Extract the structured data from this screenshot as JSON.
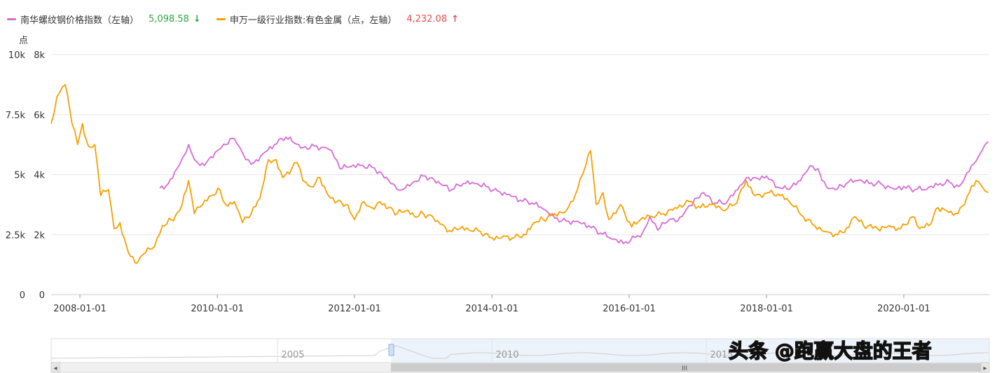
{
  "legend": {
    "series1": {
      "name": "南华螺纹钢价格指数（左轴）",
      "value": "5,098.58",
      "arrow": "↓",
      "color": "#d66bd6"
    },
    "series2": {
      "name": "申万一级行业指数:有色金属（点，左轴）",
      "value": "4,232.08",
      "arrow": "↑",
      "color": "#f5a000"
    }
  },
  "watermark": "头条 @跑赢大盘的王者",
  "navigator": {
    "labels": [
      "2005",
      "2010",
      "2015"
    ],
    "scroll_left": "◂",
    "scroll_right": "▸",
    "grip": "III"
  },
  "colors": {
    "grid": "#e6e6e6",
    "axis_text": "#333333",
    "up": "#e44d4d",
    "down": "#28a745"
  },
  "chart_data": {
    "type": "line",
    "y_unit_label": "点",
    "y_axis_outer": {
      "ticks": [
        "0",
        "2.5k",
        "5k",
        "7.5k",
        "10k"
      ],
      "ylim": [
        0,
        10000
      ]
    },
    "y_axis_inner": {
      "ticks": [
        "0",
        "2k",
        "4k",
        "6k",
        "8k"
      ],
      "ylim": [
        0,
        8000
      ]
    },
    "x_ticks": [
      "2008-01-01",
      "2010-01-01",
      "2012-01-01",
      "2014-01-01",
      "2016-01-01",
      "2018-01-01",
      "2020-01-01"
    ],
    "xlim": [
      "2007-08-01",
      "2021-03-31"
    ],
    "grid": true,
    "series": [
      {
        "name": "南华螺纹钢价格指数（左轴）",
        "color": "#d66bd6",
        "axis": "inner",
        "points": [
          [
            "2009-03-01",
            3550
          ],
          [
            "2009-04-15",
            3700
          ],
          [
            "2009-06-01",
            4200
          ],
          [
            "2009-07-15",
            4700
          ],
          [
            "2009-08-01",
            5000
          ],
          [
            "2009-09-01",
            4500
          ],
          [
            "2009-10-01",
            4300
          ],
          [
            "2009-11-15",
            4500
          ],
          [
            "2010-01-01",
            4800
          ],
          [
            "2010-02-15",
            5000
          ],
          [
            "2010-04-01",
            5200
          ],
          [
            "2010-05-01",
            4900
          ],
          [
            "2010-06-01",
            4500
          ],
          [
            "2010-07-15",
            4400
          ],
          [
            "2010-09-01",
            4700
          ],
          [
            "2010-11-01",
            5000
          ],
          [
            "2011-01-01",
            5250
          ],
          [
            "2011-02-15",
            5050
          ],
          [
            "2011-04-01",
            4900
          ],
          [
            "2011-06-01",
            4950
          ],
          [
            "2011-08-01",
            4900
          ],
          [
            "2011-09-01",
            4800
          ],
          [
            "2011-10-15",
            4200
          ],
          [
            "2011-12-01",
            4250
          ],
          [
            "2012-02-01",
            4300
          ],
          [
            "2012-04-01",
            4250
          ],
          [
            "2012-05-15",
            4100
          ],
          [
            "2012-07-01",
            3800
          ],
          [
            "2012-08-15",
            3500
          ],
          [
            "2012-09-15",
            3500
          ],
          [
            "2012-11-01",
            3700
          ],
          [
            "2013-01-01",
            3950
          ],
          [
            "2013-02-15",
            3900
          ],
          [
            "2013-04-01",
            3700
          ],
          [
            "2013-06-01",
            3500
          ],
          [
            "2013-08-01",
            3700
          ],
          [
            "2013-10-01",
            3700
          ],
          [
            "2013-12-01",
            3600
          ],
          [
            "2014-02-01",
            3450
          ],
          [
            "2014-04-01",
            3350
          ],
          [
            "2014-06-01",
            3150
          ],
          [
            "2014-08-01",
            3050
          ],
          [
            "2014-10-01",
            2850
          ],
          [
            "2014-12-01",
            2550
          ],
          [
            "2015-02-01",
            2450
          ],
          [
            "2015-04-01",
            2450
          ],
          [
            "2015-06-01",
            2300
          ],
          [
            "2015-08-01",
            2050
          ],
          [
            "2015-10-01",
            1850
          ],
          [
            "2015-12-01",
            1700
          ],
          [
            "2016-02-01",
            1900
          ],
          [
            "2016-03-15",
            2100
          ],
          [
            "2016-04-20",
            2600
          ],
          [
            "2016-06-01",
            2150
          ],
          [
            "2016-08-01",
            2500
          ],
          [
            "2016-09-15",
            2450
          ],
          [
            "2016-11-01",
            2850
          ],
          [
            "2016-12-15",
            3200
          ],
          [
            "2017-02-01",
            3400
          ],
          [
            "2017-04-01",
            3050
          ],
          [
            "2017-06-01",
            3050
          ],
          [
            "2017-08-01",
            3500
          ],
          [
            "2017-09-15",
            3900
          ],
          [
            "2017-11-01",
            3900
          ],
          [
            "2018-01-01",
            3950
          ],
          [
            "2018-03-15",
            3550
          ],
          [
            "2018-05-01",
            3500
          ],
          [
            "2018-07-01",
            3800
          ],
          [
            "2018-08-20",
            4300
          ],
          [
            "2018-10-01",
            4200
          ],
          [
            "2018-11-15",
            3600
          ],
          [
            "2019-01-01",
            3500
          ],
          [
            "2019-03-01",
            3700
          ],
          [
            "2019-05-01",
            3800
          ],
          [
            "2019-07-01",
            3700
          ],
          [
            "2019-09-01",
            3700
          ],
          [
            "2019-11-01",
            3550
          ],
          [
            "2020-01-01",
            3600
          ],
          [
            "2020-03-01",
            3500
          ],
          [
            "2020-05-01",
            3500
          ],
          [
            "2020-07-01",
            3650
          ],
          [
            "2020-09-01",
            3750
          ],
          [
            "2020-10-20",
            3600
          ],
          [
            "2020-12-01",
            4050
          ],
          [
            "2021-01-20",
            4450
          ],
          [
            "2021-02-20",
            4800
          ],
          [
            "2021-03-25",
            5100
          ]
        ]
      },
      {
        "name": "申万一级行业指数:有色金属（点，左轴）",
        "color": "#f5a000",
        "axis": "inner",
        "points": [
          [
            "2007-08-01",
            5700
          ],
          [
            "2007-09-01",
            6600
          ],
          [
            "2007-10-15",
            7000
          ],
          [
            "2007-11-20",
            5700
          ],
          [
            "2007-12-20",
            5000
          ],
          [
            "2008-01-15",
            5700
          ],
          [
            "2008-02-01",
            5200
          ],
          [
            "2008-03-01",
            4900
          ],
          [
            "2008-03-20",
            5000
          ],
          [
            "2008-04-20",
            3300
          ],
          [
            "2008-06-01",
            3500
          ],
          [
            "2008-07-01",
            2200
          ],
          [
            "2008-08-01",
            2400
          ],
          [
            "2008-09-15",
            1400
          ],
          [
            "2008-11-01",
            1050
          ],
          [
            "2008-12-15",
            1400
          ],
          [
            "2009-02-01",
            1600
          ],
          [
            "2009-03-15",
            2300
          ],
          [
            "2009-05-01",
            2500
          ],
          [
            "2009-06-15",
            2800
          ],
          [
            "2009-08-01",
            3800
          ],
          [
            "2009-09-01",
            2700
          ],
          [
            "2009-10-15",
            3000
          ],
          [
            "2009-12-01",
            3300
          ],
          [
            "2010-01-15",
            3500
          ],
          [
            "2010-02-15",
            3000
          ],
          [
            "2010-04-01",
            3100
          ],
          [
            "2010-05-15",
            2400
          ],
          [
            "2010-07-01",
            2700
          ],
          [
            "2010-08-15",
            3200
          ],
          [
            "2010-10-01",
            4500
          ],
          [
            "2010-11-10",
            4500
          ],
          [
            "2010-12-15",
            3900
          ],
          [
            "2011-02-01",
            4200
          ],
          [
            "2011-03-01",
            4400
          ],
          [
            "2011-04-01",
            3800
          ],
          [
            "2011-05-15",
            3600
          ],
          [
            "2011-07-01",
            3900
          ],
          [
            "2011-08-15",
            3300
          ],
          [
            "2011-10-01",
            3100
          ],
          [
            "2011-11-15",
            3000
          ],
          [
            "2012-01-01",
            2500
          ],
          [
            "2012-02-20",
            3100
          ],
          [
            "2012-04-01",
            2900
          ],
          [
            "2012-05-15",
            3100
          ],
          [
            "2012-07-01",
            2900
          ],
          [
            "2012-08-15",
            2700
          ],
          [
            "2012-10-01",
            2800
          ],
          [
            "2012-11-15",
            2600
          ],
          [
            "2013-01-01",
            2700
          ],
          [
            "2013-02-20",
            2600
          ],
          [
            "2013-04-01",
            2350
          ],
          [
            "2013-06-01",
            2100
          ],
          [
            "2013-07-15",
            2200
          ],
          [
            "2013-09-01",
            2150
          ],
          [
            "2013-11-01",
            2100
          ],
          [
            "2014-01-01",
            1900
          ],
          [
            "2014-03-01",
            1950
          ],
          [
            "2014-05-01",
            1900
          ],
          [
            "2014-07-01",
            2000
          ],
          [
            "2014-08-15",
            2400
          ],
          [
            "2014-10-01",
            2500
          ],
          [
            "2014-12-01",
            2700
          ],
          [
            "2015-02-01",
            2800
          ],
          [
            "2015-04-01",
            3500
          ],
          [
            "2015-05-15",
            4300
          ],
          [
            "2015-06-10",
            4800
          ],
          [
            "2015-07-10",
            3000
          ],
          [
            "2015-08-15",
            3400
          ],
          [
            "2015-09-15",
            2500
          ],
          [
            "2015-11-15",
            3000
          ],
          [
            "2016-01-15",
            2250
          ],
          [
            "2016-03-01",
            2500
          ],
          [
            "2016-05-01",
            2600
          ],
          [
            "2016-07-01",
            2700
          ],
          [
            "2016-09-01",
            2900
          ],
          [
            "2016-11-15",
            3100
          ],
          [
            "2017-01-15",
            2900
          ],
          [
            "2017-03-15",
            3000
          ],
          [
            "2017-05-15",
            2800
          ],
          [
            "2017-07-15",
            3000
          ],
          [
            "2017-09-15",
            3800
          ],
          [
            "2017-11-01",
            3300
          ],
          [
            "2018-01-15",
            3400
          ],
          [
            "2018-03-15",
            3300
          ],
          [
            "2018-05-01",
            3100
          ],
          [
            "2018-07-15",
            2600
          ],
          [
            "2018-09-15",
            2300
          ],
          [
            "2018-11-15",
            2100
          ],
          [
            "2019-01-15",
            2000
          ],
          [
            "2019-03-15",
            2250
          ],
          [
            "2019-04-15",
            2600
          ],
          [
            "2019-06-01",
            2300
          ],
          [
            "2019-08-15",
            2200
          ],
          [
            "2019-10-15",
            2300
          ],
          [
            "2019-12-15",
            2200
          ],
          [
            "2020-02-15",
            2600
          ],
          [
            "2020-03-25",
            2200
          ],
          [
            "2020-05-15",
            2300
          ],
          [
            "2020-07-01",
            2900
          ],
          [
            "2020-08-15",
            2800
          ],
          [
            "2020-10-15",
            2700
          ],
          [
            "2020-12-15",
            3400
          ],
          [
            "2021-01-20",
            3800
          ],
          [
            "2021-02-20",
            3600
          ],
          [
            "2021-03-25",
            3400
          ]
        ]
      }
    ]
  }
}
